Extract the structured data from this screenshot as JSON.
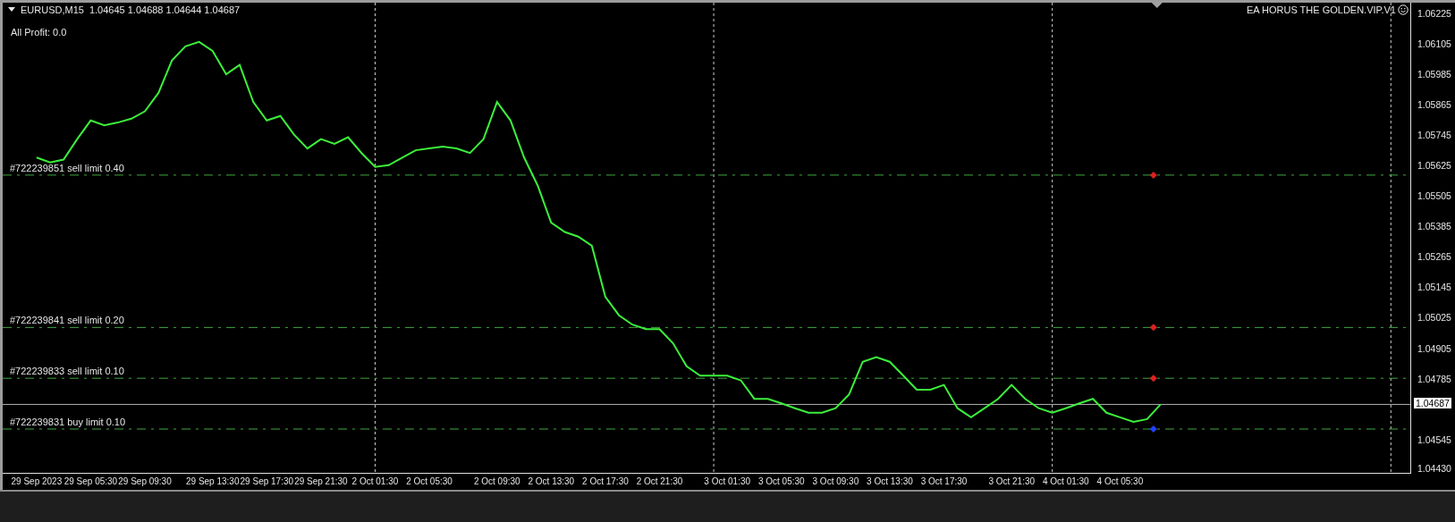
{
  "header": {
    "symbol": "EURUSD,M15",
    "quote": "1.04645 1.04688 1.04644 1.04687"
  },
  "profit": "All Profit: 0.0",
  "expert": {
    "name": "EA HORUS THE GOLDEN.VIP.V1"
  },
  "order_markers": [
    {
      "color": "#e02020"
    },
    {
      "color": "#e02020"
    },
    {
      "color": "#e02020"
    },
    {
      "color": "#2040ff"
    }
  ],
  "chart_data": {
    "type": "line",
    "grid": true,
    "ylim": [
      1.04414,
      1.06269
    ],
    "categories": [
      null,
      null,
      "29 Sep 2023",
      null,
      null,
      null,
      "29 Sep 05:30",
      null,
      null,
      null,
      "29 Sep 09:30",
      null,
      null,
      null,
      null,
      "29 Sep 13:30",
      null,
      null,
      null,
      "29 Sep 17:30",
      null,
      null,
      null,
      "29 Sep 21:30",
      null,
      null,
      null,
      "2 Oct 01:30",
      null,
      null,
      null,
      "2 Oct 05:30",
      null,
      null,
      null,
      null,
      "2 Oct 09:30",
      null,
      null,
      null,
      "2 Oct 13:30",
      null,
      null,
      null,
      "2 Oct 17:30",
      null,
      null,
      null,
      "2 Oct 21:30",
      null,
      null,
      null,
      null,
      "3 Oct 01:30",
      null,
      null,
      null,
      "3 Oct 05:30",
      null,
      null,
      null,
      "3 Oct 09:30",
      null,
      null,
      null,
      "3 Oct 13:30",
      null,
      null,
      null,
      "3 Oct 17:30",
      null,
      null,
      null,
      null,
      "3 Oct 21:30",
      null,
      null,
      null,
      "4 Oct 01:30",
      null,
      null,
      null,
      "4 Oct 05:30",
      null,
      null,
      null,
      null,
      null,
      null,
      null,
      null,
      null,
      null,
      null,
      null,
      null,
      null,
      null,
      null,
      null,
      null,
      null,
      null,
      null
    ],
    "series": [
      {
        "color": "#3cf03c",
        "values": [
          null,
          null,
          1.05659,
          1.0564,
          1.05651,
          1.05732,
          1.05805,
          1.05786,
          1.05797,
          1.05812,
          1.05841,
          1.05914,
          1.06042,
          1.06097,
          1.06115,
          1.06079,
          1.05987,
          1.06024,
          1.05878,
          1.05805,
          1.05823,
          1.0575,
          1.05695,
          1.05732,
          1.05713,
          1.05739,
          1.05677,
          1.05622,
          1.05629,
          1.05659,
          1.05688,
          1.05695,
          1.05702,
          1.05695,
          1.05677,
          1.05732,
          1.05878,
          1.05805,
          1.05659,
          1.05549,
          1.05403,
          1.05366,
          1.05348,
          1.05312,
          1.05111,
          1.05038,
          1.05001,
          1.04983,
          1.04983,
          1.04928,
          1.04837,
          1.048,
          1.048,
          1.048,
          1.04782,
          1.04709,
          1.04709,
          1.04691,
          1.04672,
          1.04654,
          1.04654,
          1.04672,
          1.04727,
          1.04855,
          1.04873,
          1.04855,
          1.048,
          1.04745,
          1.04745,
          1.04764,
          1.04672,
          1.04636,
          1.04672,
          1.04709,
          1.04764,
          1.04709,
          1.04672,
          1.04654,
          1.04672,
          1.04691,
          1.04709,
          1.04654,
          1.04636,
          1.04618,
          1.04629,
          1.04687,
          null,
          null,
          null,
          null,
          null,
          null,
          null,
          null,
          null,
          null,
          null,
          null,
          null,
          null,
          null,
          null,
          null,
          null
        ]
      }
    ],
    "yticks": [
      {
        "value": 1.06225,
        "label": "1.06225"
      },
      {
        "value": 1.06105,
        "label": "1.06105"
      },
      {
        "value": 1.05985,
        "label": "1.05985"
      },
      {
        "value": 1.05865,
        "label": "1.05865"
      },
      {
        "value": 1.05745,
        "label": "1.05745"
      },
      {
        "value": 1.05625,
        "label": "1.05625"
      },
      {
        "value": 1.05505,
        "label": "1.05505"
      },
      {
        "value": 1.05385,
        "label": "1.05385"
      },
      {
        "value": 1.05265,
        "label": "1.05265"
      },
      {
        "value": 1.05145,
        "label": "1.05145"
      },
      {
        "value": 1.05025,
        "label": "1.05025"
      },
      {
        "value": 1.04905,
        "label": "1.04905"
      },
      {
        "value": 1.04785,
        "label": "1.04785"
      },
      {
        "value": 1.04545,
        "label": "1.04545"
      },
      {
        "value": 1.0443,
        "label": "1.04430"
      }
    ],
    "ref_lines": [
      {
        "axis": "y",
        "label": "#722239851 sell limit 0.40",
        "value": 1.0559,
        "color": "#3fa83f"
      },
      {
        "axis": "y",
        "label": "#722239841 sell limit 0.20",
        "value": 1.0499,
        "color": "#3fa83f"
      },
      {
        "axis": "y",
        "label": "#722239833 sell limit 0.10",
        "value": 1.0479,
        "color": "#3fa83f"
      },
      {
        "axis": "y",
        "label": "#722239831 buy limit 0.10",
        "value": 1.0459,
        "color": "#3fa83f"
      },
      {
        "axis": "y",
        "label": "1.04687",
        "value": 1.04687,
        "color": "#b0b0b0"
      }
    ]
  }
}
